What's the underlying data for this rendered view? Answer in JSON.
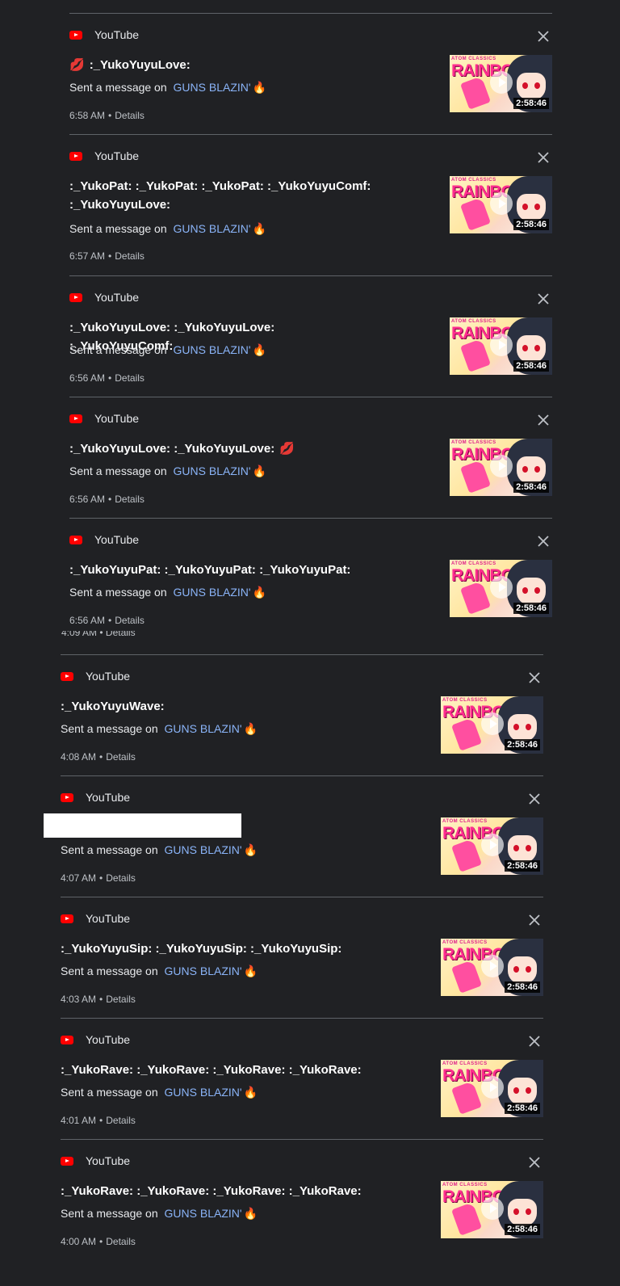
{
  "colors": {
    "background": "#202124",
    "link": "#8ab4f8",
    "youtube_red": "#ff0000",
    "divider": "#5f6368"
  },
  "icons": {
    "app": "youtube-icon",
    "close": "close-icon",
    "lips": "lips-emoji",
    "flame": "fire-emoji",
    "play": "play-icon"
  },
  "common": {
    "app_name": "YouTube",
    "sent_prefix": "Sent a message on",
    "channel_link": "GUNS BLAZIN'",
    "flame": "🔥",
    "details": "Details",
    "dot": "•",
    "duration": "2:58:46",
    "thumb_word": "RAINBOW",
    "thumb_brand": "ATOM CLASSICS"
  },
  "notifications": [
    {
      "lips_prefix": "💋",
      "title": ":_YukoYuyuLove:",
      "title_suffix": "",
      "time": "6:58 AM"
    },
    {
      "lips_prefix": "",
      "title": ":_YukoPat: :_YukoPat: :_YukoPat: :_YukoYuyuComf: :_YukoYuyuLove:",
      "title_suffix": "",
      "time": "6:57 AM"
    },
    {
      "lips_prefix": "",
      "title": ":_YukoYuyuLove: :_YukoYuyuLove: :_YukoYuyuComf:",
      "title_suffix": "",
      "time": "6:56 AM"
    },
    {
      "lips_prefix": "",
      "title": ":_YukoYuyuLove: :_YukoYuyuLove:",
      "title_suffix": "💋",
      "time": "6:56 AM"
    },
    {
      "lips_prefix": "",
      "title": ":_YukoYuyuPat: :_YukoYuyuPat: :_YukoYuyuPat:",
      "title_suffix": "",
      "time": "6:56 AM"
    },
    {
      "lips_prefix": "",
      "title": ":_YukoYuyuWave:",
      "title_suffix": "",
      "time": "4:08 AM"
    },
    {
      "lips_prefix": "",
      "title": "",
      "title_suffix": "",
      "time": "4:07 AM"
    },
    {
      "lips_prefix": "",
      "title": ":_YukoYuyuSip: :_YukoYuyuSip: :_YukoYuyuSip:",
      "title_suffix": "",
      "time": "4:03 AM"
    },
    {
      "lips_prefix": "",
      "title": ":_YukoRave: :_YukoRave: :_YukoRave: :_YukoRave:",
      "title_suffix": "",
      "time": "4:01 AM"
    },
    {
      "lips_prefix": "",
      "title": ":_YukoRave: :_YukoRave: :_YukoRave: :_YukoRave:",
      "title_suffix": "",
      "time": "4:00 AM"
    }
  ],
  "cutoff_time_text": "4:09 AM • Details"
}
